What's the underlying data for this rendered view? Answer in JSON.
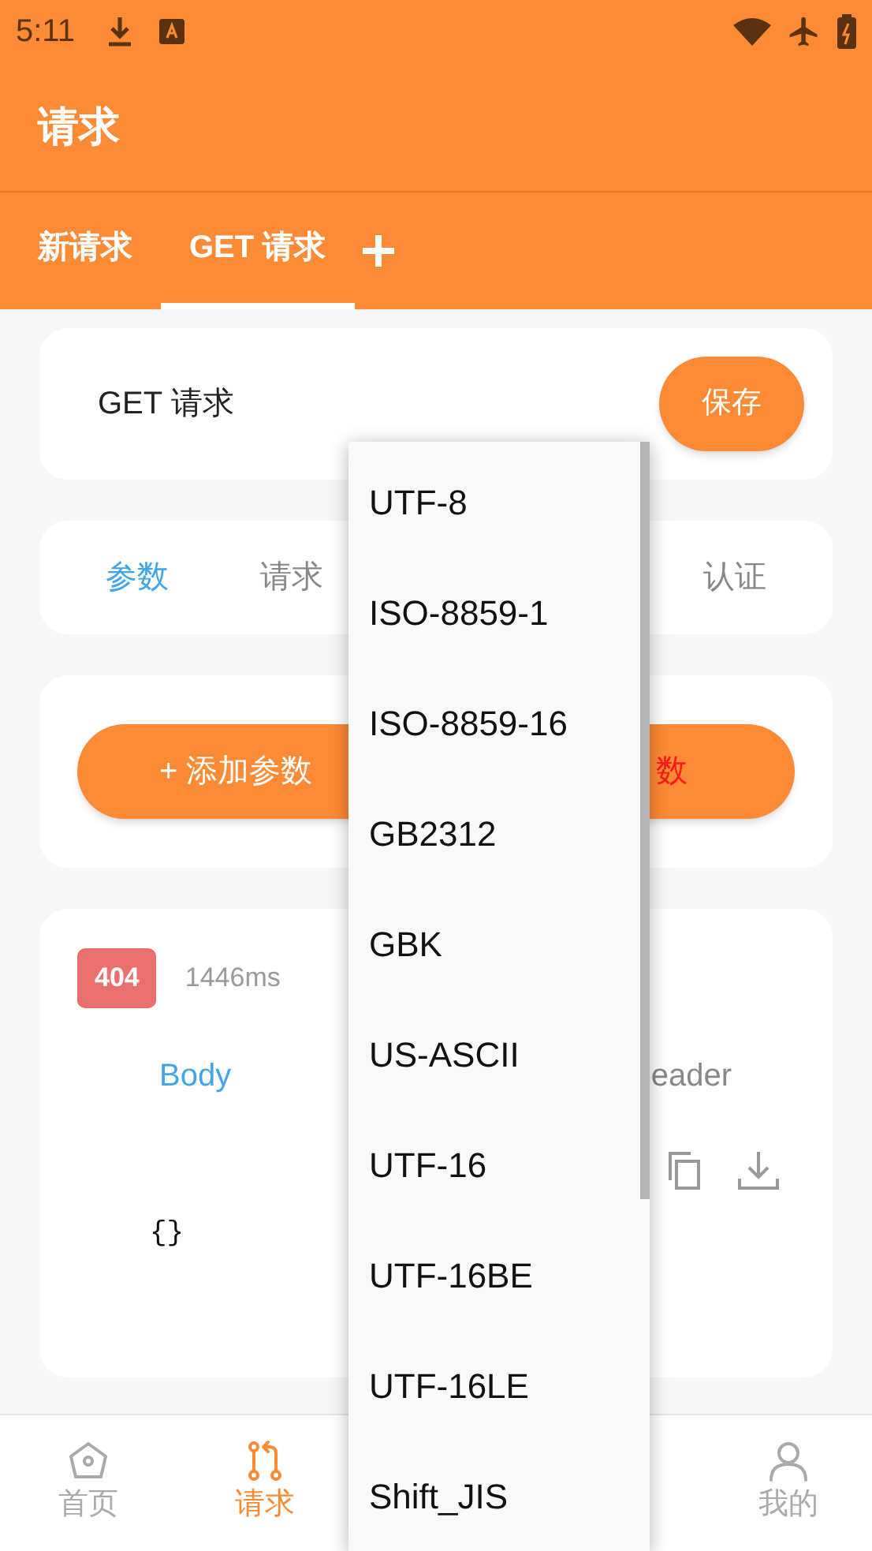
{
  "status_bar": {
    "time": "5:11"
  },
  "app_bar": {
    "title": "请求"
  },
  "tabs": [
    {
      "label": "新请求",
      "selected": false
    },
    {
      "label": "GET 请求",
      "selected": true
    }
  ],
  "request_card": {
    "name": "GET 请求",
    "save_button": "保存"
  },
  "section_tabs": [
    {
      "label": "参数",
      "selected": true
    },
    {
      "label": "请求",
      "selected": false
    },
    {
      "label": "认证",
      "selected": false
    }
  ],
  "actions": {
    "add_button": "+ 添加参数",
    "clear_button": "数"
  },
  "response": {
    "status_code": "404",
    "time": "1446ms",
    "tabs": [
      {
        "label": "Body",
        "selected": true
      },
      {
        "label": "eader",
        "selected": false
      }
    ],
    "body": "{}"
  },
  "encoding_menu": {
    "items": [
      "UTF-8",
      "ISO-8859-1",
      "ISO-8859-16",
      "GB2312",
      "GBK",
      "US-ASCII",
      "UTF-16",
      "UTF-16BE",
      "UTF-16LE",
      "Shift_JIS"
    ]
  },
  "bottom_nav": [
    {
      "kind": "home",
      "label": "首页",
      "selected": false
    },
    {
      "kind": "request",
      "label": "请求",
      "selected": true
    },
    {
      "kind": "profile",
      "label": "我的",
      "selected": false
    }
  ]
}
